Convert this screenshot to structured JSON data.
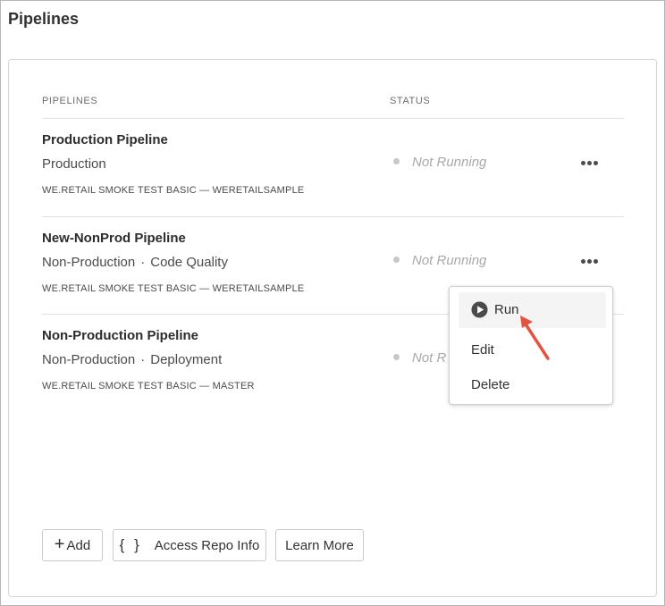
{
  "page": {
    "title": "Pipelines"
  },
  "table": {
    "col_pipelines": "PIPELINES",
    "col_status": "STATUS",
    "rows": [
      {
        "name": "Production Pipeline",
        "type": "Production",
        "sub": "",
        "repo": "WE.RETAIL SMOKE TEST BASIC — WERETAILSAMPLE",
        "status": "Not Running"
      },
      {
        "name": "New-NonProd Pipeline",
        "type": "Non-Production",
        "sub": "Code Quality",
        "repo": "WE.RETAIL SMOKE TEST BASIC — WERETAILSAMPLE",
        "status": "Not Running"
      },
      {
        "name": "Non-Production Pipeline",
        "type": "Non-Production",
        "sub": "Deployment",
        "repo": "WE.RETAIL SMOKE TEST BASIC — MASTER",
        "status": "Not R"
      }
    ]
  },
  "separator": "·",
  "actions": {
    "add": "Add",
    "add_icon": "+",
    "repo_icon": "{ }",
    "repo": "Access Repo Info",
    "learn": "Learn More"
  },
  "menu": {
    "run": "Run",
    "edit": "Edit",
    "delete": "Delete"
  },
  "colors": {
    "accent_arrow": "#e2543f",
    "status_text": "#a8a8a8"
  }
}
